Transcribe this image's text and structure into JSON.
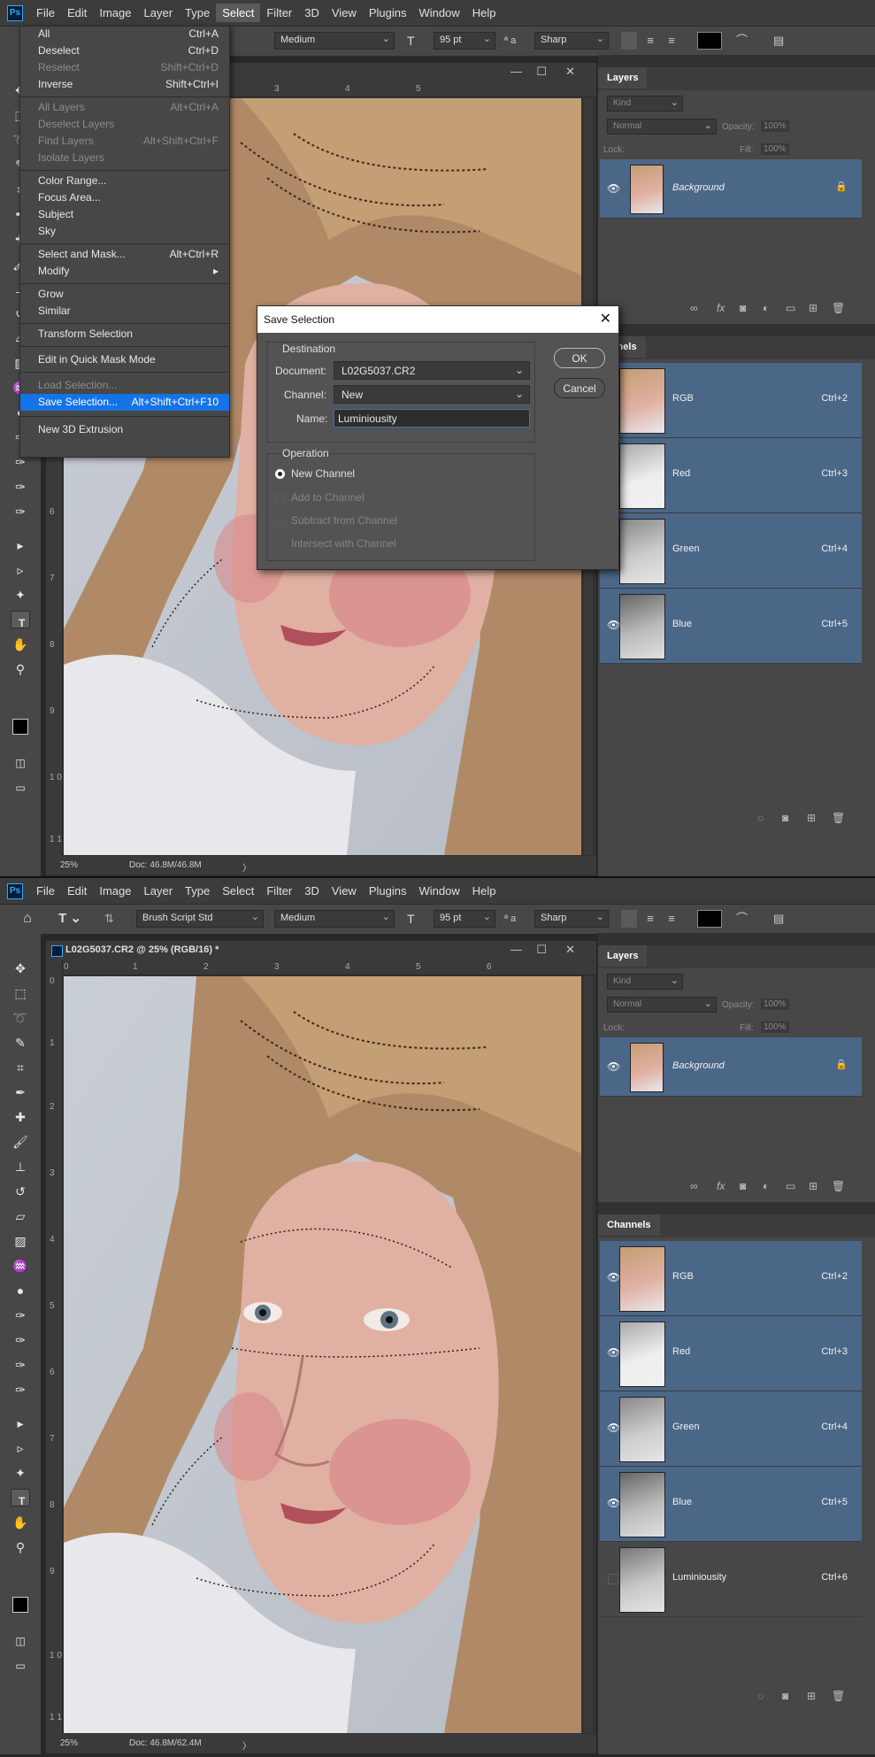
{
  "app": {
    "logo": "Ps"
  },
  "menubar": [
    "File",
    "Edit",
    "Image",
    "Layer",
    "Type",
    "Select",
    "Filter",
    "3D",
    "View",
    "Plugins",
    "Window",
    "Help"
  ],
  "options_bar": {
    "font_family": "Brush Script Std",
    "font_style": "Medium",
    "font_size": "95 pt",
    "antialias": "Sharp",
    "aa_glyph": "ª a"
  },
  "document": {
    "title": "L02G5037.CR2 @ 25% (RGB/16) *",
    "zoom": "25%",
    "doc_size_top": "Doc: 46.8M/46.8M",
    "doc_size_bottom": "Doc: 46.8M/62.4M",
    "status_arrow": "〉"
  },
  "ruler_h": [
    "0",
    "1",
    "2",
    "3",
    "4",
    "5",
    "6"
  ],
  "ruler_v": [
    "0",
    "1",
    "2",
    "3",
    "4",
    "5",
    "6",
    "7",
    "8",
    "9",
    "1 0",
    "1 1"
  ],
  "select_menu": {
    "items": [
      {
        "label": "All",
        "shortcut": "Ctrl+A",
        "disabled": false
      },
      {
        "label": "Deselect",
        "shortcut": "Ctrl+D",
        "disabled": false
      },
      {
        "label": "Reselect",
        "shortcut": "Shift+Ctrl+D",
        "disabled": true
      },
      {
        "label": "Inverse",
        "shortcut": "Shift+Ctrl+I",
        "disabled": false
      },
      {
        "label": "All Layers",
        "shortcut": "Alt+Ctrl+A",
        "disabled": true
      },
      {
        "label": "Deselect Layers",
        "shortcut": "",
        "disabled": true
      },
      {
        "label": "Find Layers",
        "shortcut": "Alt+Shift+Ctrl+F",
        "disabled": true
      },
      {
        "label": "Isolate Layers",
        "shortcut": "",
        "disabled": true
      },
      {
        "label": "Color Range...",
        "shortcut": "",
        "disabled": false
      },
      {
        "label": "Focus Area...",
        "shortcut": "",
        "disabled": false
      },
      {
        "label": "Subject",
        "shortcut": "",
        "disabled": false
      },
      {
        "label": "Sky",
        "shortcut": "",
        "disabled": false
      },
      {
        "label": "Select and Mask...",
        "shortcut": "Alt+Ctrl+R",
        "disabled": false
      },
      {
        "label": "Modify",
        "shortcut": "▸",
        "disabled": false
      },
      {
        "label": "Grow",
        "shortcut": "",
        "disabled": false
      },
      {
        "label": "Similar",
        "shortcut": "",
        "disabled": false
      },
      {
        "label": "Transform Selection",
        "shortcut": "",
        "disabled": false
      },
      {
        "label": "Edit in Quick Mask Mode",
        "shortcut": "",
        "disabled": false
      },
      {
        "label": "Load Selection...",
        "shortcut": "",
        "disabled": true
      },
      {
        "label": "Save Selection...",
        "shortcut": "Alt+Shift+Ctrl+F10",
        "disabled": false,
        "highlighted": true
      },
      {
        "label": "New 3D Extrusion",
        "shortcut": "",
        "disabled": false
      }
    ]
  },
  "save_dialog": {
    "title": "Save Selection",
    "close": "✕",
    "destination_legend": "Destination",
    "document_label": "Document:",
    "document_value": "L02G5037.CR2",
    "channel_label": "Channel:",
    "channel_value": "New",
    "name_label": "Name:",
    "name_value": "Luminiousity",
    "ok": "OK",
    "cancel": "Cancel",
    "operation_legend": "Operation",
    "operations": [
      "New Channel",
      "Add to Channel",
      "Subtract from Channel",
      "Intersect with Channel"
    ]
  },
  "layers_panel": {
    "title": "Layers",
    "kind": "Kind",
    "blend": "Normal",
    "opacity_label": "Opacity:",
    "opacity": "100%",
    "lock_label": "Lock:",
    "fill_label": "Fill:",
    "fill": "100%",
    "layer_name": "Background"
  },
  "channels_panel": {
    "title": "Channels",
    "title_clipped": "nannels",
    "channels": [
      {
        "name": "RGB",
        "key": "Ctrl+2"
      },
      {
        "name": "Red",
        "key": "Ctrl+3"
      },
      {
        "name": "Green",
        "key": "Ctrl+4"
      },
      {
        "name": "Blue",
        "key": "Ctrl+5"
      },
      {
        "name": "Luminiousity",
        "key": "Ctrl+6"
      }
    ]
  },
  "colors": {
    "highlight": "#1473e6",
    "channel_row": "#4b6788",
    "panel": "#474747"
  }
}
